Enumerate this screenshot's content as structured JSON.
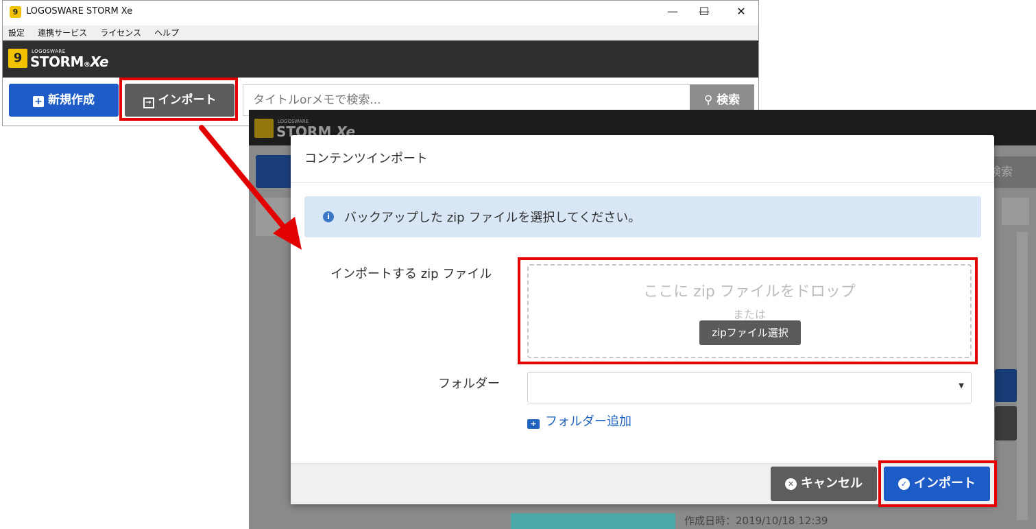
{
  "window": {
    "title": "LOGOSWARE STORM Xe",
    "controls": {
      "minimize": "—",
      "maximize": "☐",
      "close": "✕"
    },
    "menu": [
      "設定",
      "連携サービス",
      "ライセンス",
      "ヘルプ"
    ],
    "logo": {
      "small": "LOGOSWARE",
      "big": "STORM",
      "suffix": "Xe"
    }
  },
  "toolbar": {
    "new_label": "新規作成",
    "import_label": "インポート",
    "search_placeholder": "タイトルorメモで検索...",
    "search_label": "検索"
  },
  "background": {
    "search_label": "検索",
    "list_date": "作成日時：2019/10/18 12:39"
  },
  "modal": {
    "title": "コンテンツインポート",
    "info_text": "バックアップした zip ファイルを選択してください。",
    "zip_label": "インポートする zip ファイル",
    "drop_text": "ここに zip ファイルをドロップ",
    "or_text": "または",
    "select_button": "zipファイル選択",
    "folder_label": "フォルダー",
    "folder_value": "",
    "add_folder": "フォルダー追加",
    "cancel_label": "キャンセル",
    "import_label": "インポート"
  },
  "colors": {
    "primary": "#1d5bc6",
    "highlight": "#e30000",
    "info_bg": "#d9e6f5",
    "brand_bar": "#2f2f2f",
    "logo_yellow": "#f2c200"
  }
}
